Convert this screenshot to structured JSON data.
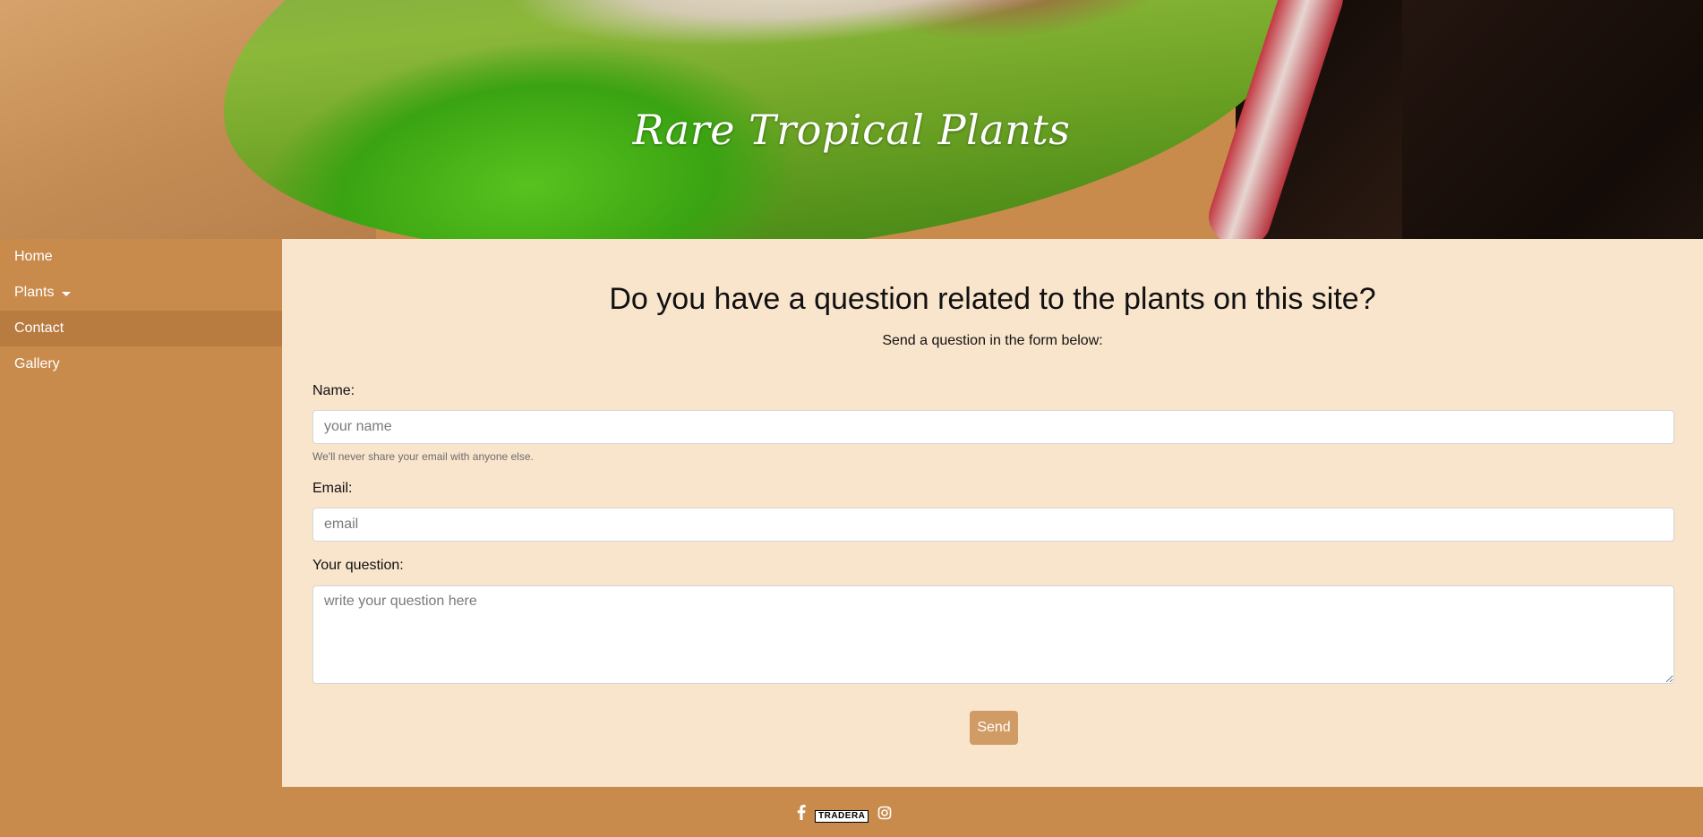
{
  "header": {
    "title": "Rare Tropical Plants"
  },
  "sidebar": {
    "items": [
      {
        "label": "Home"
      },
      {
        "label": "Plants"
      },
      {
        "label": "Contact"
      },
      {
        "label": "Gallery"
      }
    ],
    "active": "Contact"
  },
  "main": {
    "heading": "Do you have a question related to the plants on this site?",
    "subtitle": "Send a question in the form below:",
    "form": {
      "name_label": "Name:",
      "name_placeholder": "your name",
      "help_text": "We'll never share your email with anyone else.",
      "email_label": "Email:",
      "email_placeholder": "email",
      "question_label": "Your question:",
      "question_placeholder": "write your question here",
      "send_label": "Send"
    }
  },
  "footer": {
    "icons": [
      "facebook-icon",
      "tradera-logo",
      "instagram-icon"
    ],
    "tradera_text": "TRADERA"
  },
  "colors": {
    "sidebar_bg": "#c98b4c",
    "active_nav_bg": "#b87b40",
    "content_bg": "#f9e4cc",
    "button_bg": "#d19b65"
  }
}
